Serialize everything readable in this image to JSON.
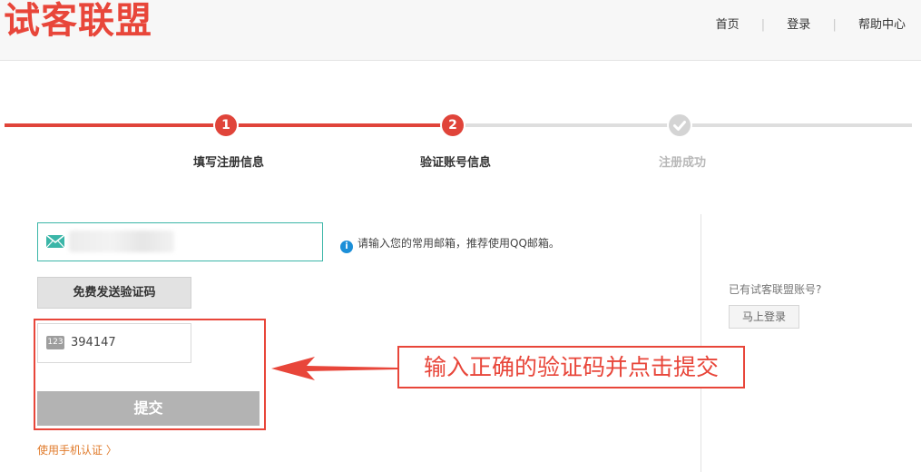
{
  "header": {
    "logo": "试客联盟",
    "nav": [
      {
        "label": "首页"
      },
      {
        "label": "登录"
      },
      {
        "label": "帮助中心"
      }
    ]
  },
  "stepper": {
    "steps": [
      {
        "number": "1",
        "label": "填写注册信息",
        "state": "done"
      },
      {
        "number": "2",
        "label": "验证账号信息",
        "state": "current"
      },
      {
        "number": "",
        "label": "注册成功",
        "state": "pending"
      }
    ]
  },
  "form": {
    "email_hint": "请输入您的常用邮箱，推荐使用QQ邮箱。",
    "send_code_label": "免费发送验证码",
    "code_icon": "123",
    "code_value": "394147",
    "submit_label": "提交",
    "phone_link": "使用手机认证 〉"
  },
  "side": {
    "have_account": "已有试客联盟账号?",
    "login_label": "马上登录"
  },
  "annotation": {
    "text": "输入正确的验证码并点击提交"
  },
  "colors": {
    "brand": "#e8463a",
    "accent_teal": "#3bb6a8",
    "info_blue": "#1c8fd8",
    "link_orange": "#e07a2a"
  }
}
